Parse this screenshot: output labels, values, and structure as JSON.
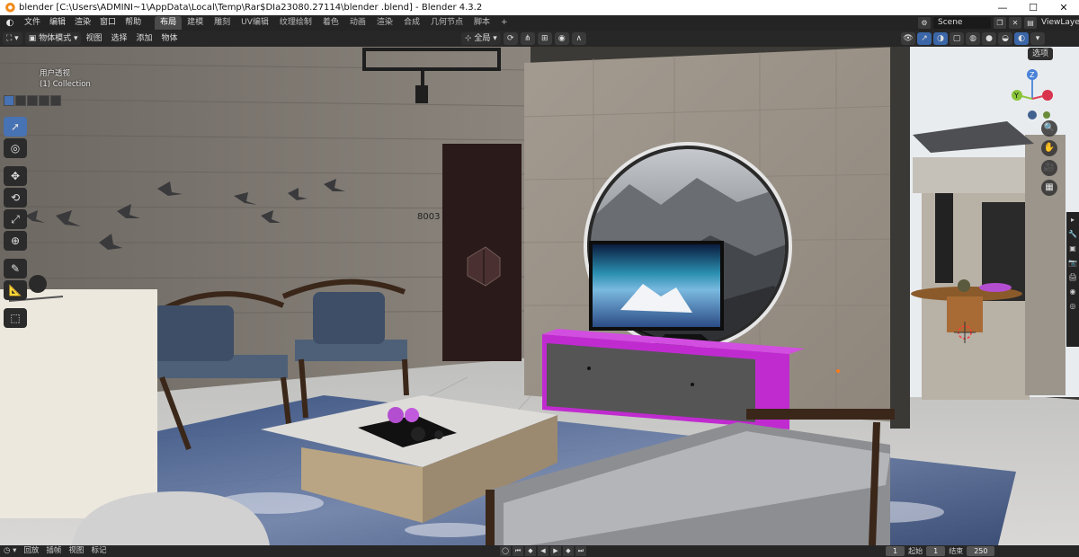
{
  "window": {
    "title": "blender  [C:\\Users\\ADMINI~1\\AppData\\Local\\Temp\\Rar$DIa23080.27114\\blender .blend] - Blender 4.3.2"
  },
  "menu": {
    "items": [
      "文件",
      "编辑",
      "渲染",
      "窗口",
      "帮助"
    ]
  },
  "workspaces": {
    "tabs": [
      "布局",
      "建模",
      "雕刻",
      "UV编辑",
      "纹理绘制",
      "着色",
      "动画",
      "渲染",
      "合成",
      "几何节点",
      "脚本",
      "+"
    ],
    "active": "布局"
  },
  "topright": {
    "scene": "Scene",
    "view_layer": "ViewLayer"
  },
  "viewport_header": {
    "mode": "物体模式",
    "menus": [
      "视图",
      "选择",
      "添加",
      "物体"
    ],
    "transform_orientation": "全局"
  },
  "viewport": {
    "view_name": "用户透视",
    "collection": "(1) Collection",
    "options_label": "选项",
    "room_number": "8003"
  },
  "gizmo": {
    "z": "Z",
    "y": "Y"
  },
  "timeline": {
    "items": [
      "回放",
      "插帧",
      "视图",
      "标记"
    ],
    "current_frame": "1",
    "start_label": "起始",
    "start": "1",
    "end_label": "结束",
    "end": "250"
  },
  "colors": {
    "accent": "#4772b3",
    "tv_stand": "#c02bd0"
  }
}
